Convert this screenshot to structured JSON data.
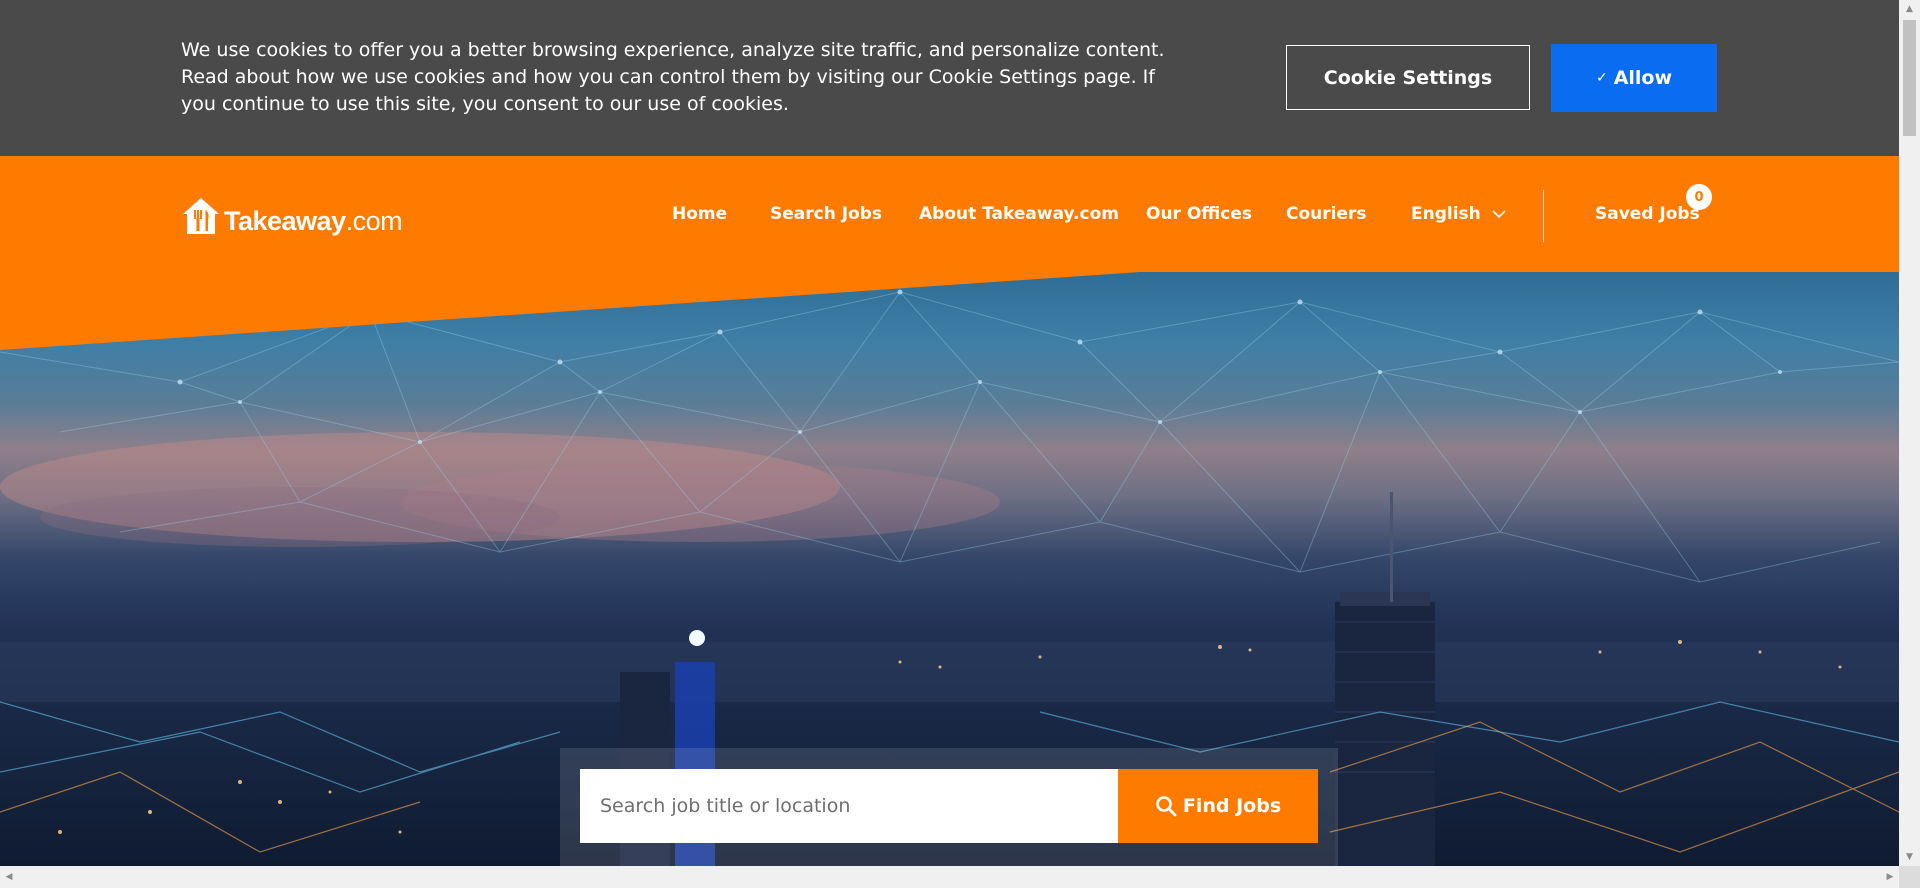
{
  "cookie_banner": {
    "message": "We use cookies to offer you a better browsing experience, analyze site traffic, and personalize content. Read about how we use cookies and how you can control them by visiting our Cookie Settings page. If you continue to use this site, you consent to our use of cookies.",
    "settings_label": "Cookie Settings",
    "allow_label": "Allow",
    "colors": {
      "background": "#4a4a4a",
      "allow": "#0a6cf0"
    }
  },
  "header": {
    "logo": {
      "brand": "Takeaway",
      "suffix": ".com",
      "icon": "house-fork-knife-icon"
    },
    "nav": [
      {
        "label": "Home"
      },
      {
        "label": "Search Jobs"
      },
      {
        "label": "About Takeaway.com"
      },
      {
        "label": "Our Offices"
      },
      {
        "label": "Couriers"
      }
    ],
    "language": {
      "label": "English",
      "icon": "chevron-down-icon"
    },
    "saved_jobs": {
      "label": "Saved Jobs",
      "count": "0"
    },
    "colors": {
      "brand": "#ff7b00"
    }
  },
  "search": {
    "placeholder": "Search job title or location",
    "button_label": "Find Jobs",
    "button_icon": "search-icon"
  }
}
